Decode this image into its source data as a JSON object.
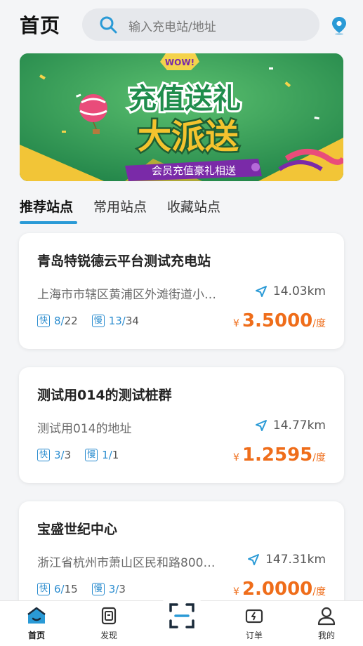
{
  "header": {
    "title": "首页",
    "search_placeholder": "输入充电站/地址"
  },
  "banner": {
    "badge": "WOW!",
    "line1": "充值送礼",
    "line2": "大派送",
    "ribbon": "会员充值豪礼相送"
  },
  "tabs": [
    {
      "label": "推荐站点",
      "active": true
    },
    {
      "label": "常用站点",
      "active": false
    },
    {
      "label": "收藏站点",
      "active": false
    }
  ],
  "stations": [
    {
      "name": "青岛特锐德云平台测试充电站",
      "address": "上海市市辖区黄浦区外滩街道小…",
      "distance": "14.03km",
      "fast_label": "快",
      "fast_free": "8",
      "fast_total": "22",
      "slow_label": "慢",
      "slow_free": "13",
      "slow_total": "34",
      "currency": "¥",
      "price": "3.5000",
      "unit": "/度"
    },
    {
      "name": "测试用014的测试桩群",
      "address": "测试用014的地址",
      "distance": "14.77km",
      "fast_label": "快",
      "fast_free": "3",
      "fast_total": "3",
      "slow_label": "慢",
      "slow_free": "1",
      "slow_total": "1",
      "currency": "¥",
      "price": "1.2595",
      "unit": "/度"
    },
    {
      "name": "宝盛世纪中心",
      "address": "浙江省杭州市萧山区民和路800…",
      "distance": "147.31km",
      "fast_label": "快",
      "fast_free": "6",
      "fast_total": "15",
      "slow_label": "慢",
      "slow_free": "3",
      "slow_total": "3",
      "currency": "¥",
      "price": "2.0000",
      "unit": "/度"
    }
  ],
  "nav": {
    "home": "首页",
    "discover": "发现",
    "orders": "订单",
    "mine": "我的"
  },
  "colors": {
    "accent": "#2a9ad6",
    "price": "#ef6d1a",
    "banner_green": "#2f9a53"
  },
  "icons": [
    "search-icon",
    "location-pin-icon",
    "navigate-arrow-icon",
    "home-icon",
    "discover-icon",
    "scan-icon",
    "order-icon",
    "profile-icon"
  ]
}
